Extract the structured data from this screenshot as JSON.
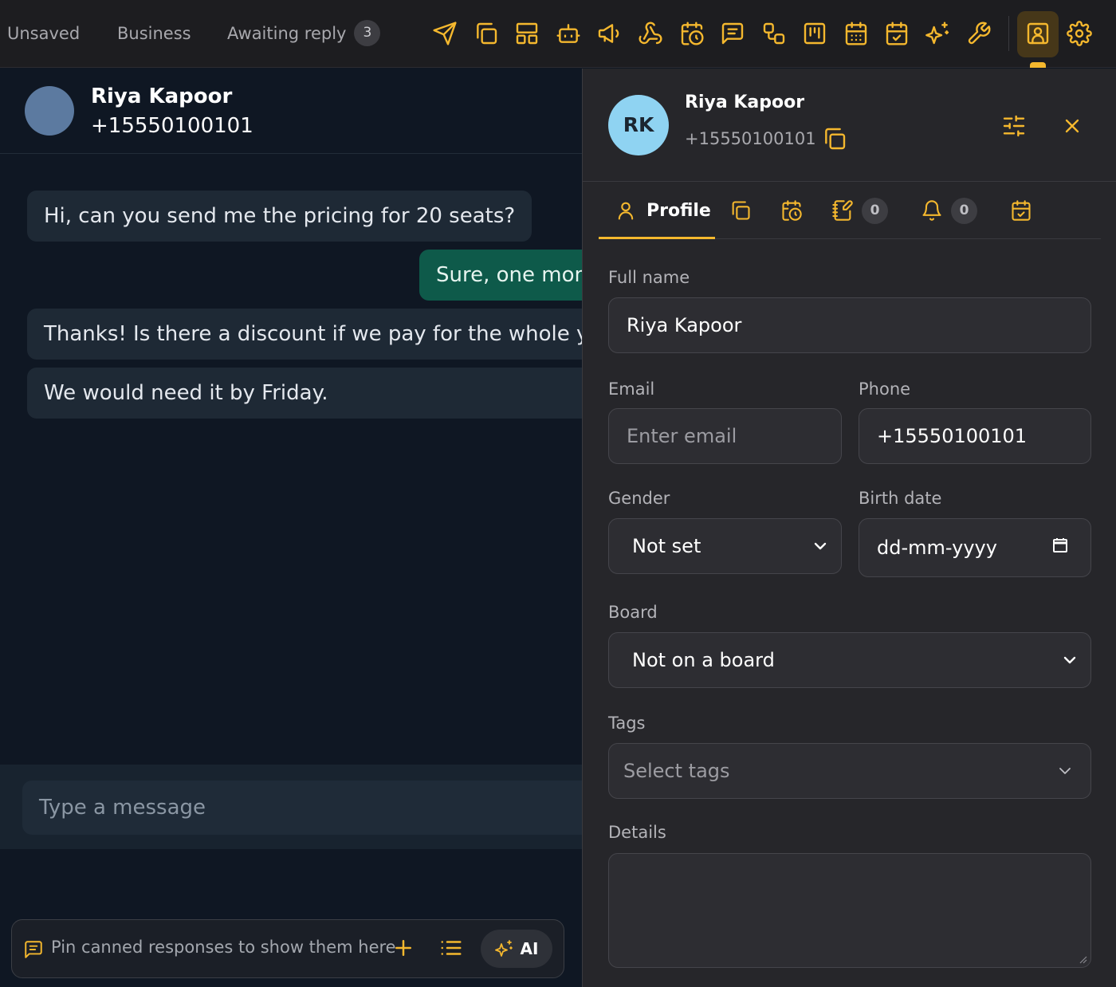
{
  "topbar": {
    "tabs": [
      {
        "label": "Unsaved"
      },
      {
        "label": "Business"
      },
      {
        "label": "Awaiting reply",
        "count": "3"
      }
    ],
    "icons": [
      "send-icon",
      "copy-icon",
      "layout-icon",
      "bot-icon",
      "megaphone-icon",
      "webhook-icon",
      "calendar-clock-icon",
      "message-square-icon",
      "workflow-icon",
      "kanban-icon",
      "calendar-grid-icon",
      "calendar-check-icon",
      "sparkles-icon",
      "wrench-icon",
      "contact-card-icon",
      "gear-icon"
    ],
    "accent": "#f5b82e"
  },
  "chat": {
    "name": "Riya Kapoor",
    "phone": "+15550100101",
    "messages": [
      {
        "dir": "in",
        "text": "Hi, can you send me the pricing for 20 seats?"
      },
      {
        "dir": "out",
        "text": "Sure, one moment"
      },
      {
        "dir": "in",
        "text": "Thanks! Is there a discount if we pay for the whole year?"
      },
      {
        "dir": "in",
        "text": "We would need it by Friday."
      }
    ],
    "composer_placeholder": "Type a message",
    "canned_hint": "Pin canned responses to show them here",
    "ai_label": "AI"
  },
  "panel": {
    "initials": "RK",
    "name": "Riya Kapoor",
    "phone": "+15550100101",
    "tabs": {
      "profile_label": "Profile",
      "notes_count": "0",
      "reminders_count": "0"
    },
    "fields": {
      "full_name_label": "Full name",
      "full_name_value": "Riya Kapoor",
      "email_label": "Email",
      "email_placeholder": "Enter email",
      "phone_label": "Phone",
      "phone_value": "+15550100101",
      "gender_label": "Gender",
      "gender_value": "Not set",
      "birth_label": "Birth date",
      "birth_placeholder": "dd-mm-yyyy",
      "board_label": "Board",
      "board_value": "Not on a board",
      "tags_label": "Tags",
      "tags_placeholder": "Select tags",
      "details_label": "Details"
    }
  }
}
